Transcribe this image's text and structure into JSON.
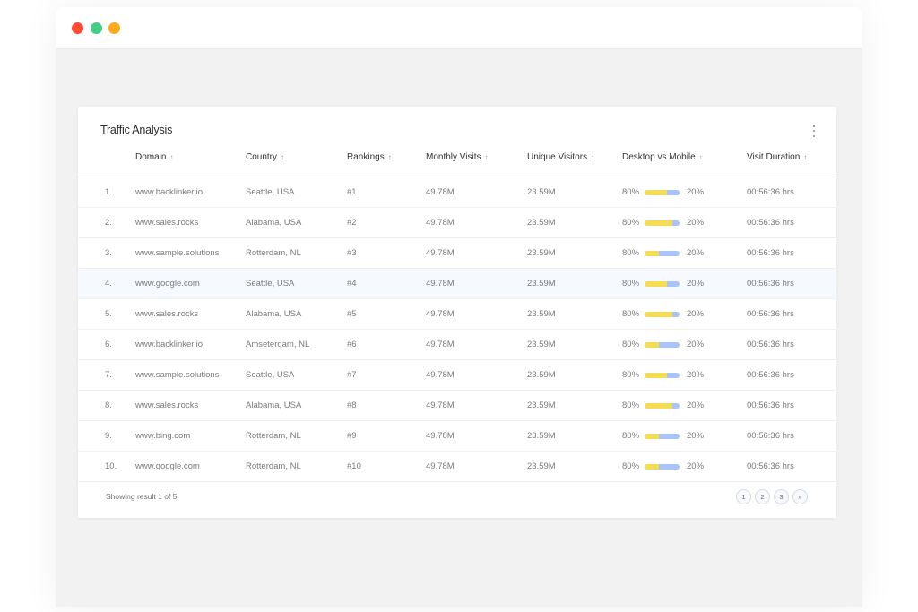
{
  "window": {
    "controls": [
      "close",
      "maximize",
      "minimize"
    ]
  },
  "card": {
    "title": "Traffic Analysis",
    "menu_icon": "more-vertical-icon"
  },
  "table": {
    "sort_icon": "sort-icon",
    "headers": {
      "domain": "Domain",
      "country": "Country",
      "rankings": "Rankings",
      "monthly_visits": "Monthly Visits",
      "unique_visitors": "Unique Visitors",
      "desktop_vs_mobile": "Desktop vs Mobile",
      "visit_duration": "Visit Duration"
    },
    "sort_glyph": "↕",
    "highlighted_row": 4,
    "rows": [
      {
        "num": "1.",
        "domain": "www.backlinker.io",
        "country": "Seattle, USA",
        "rank": "#1",
        "monthly": "49.78M",
        "unique": "23.59M",
        "desktop": "80%",
        "mobile": "20%",
        "desktop_fill": 0.65,
        "duration": "00:56:36 hrs"
      },
      {
        "num": "2.",
        "domain": "www.sales.rocks",
        "country": "Alabama, USA",
        "rank": "#2",
        "monthly": "49.78M",
        "unique": "23.59M",
        "desktop": "80%",
        "mobile": "20%",
        "desktop_fill": 0.8,
        "duration": "00:56:36 hrs"
      },
      {
        "num": "3.",
        "domain": "www.sample.solutions",
        "country": "Rotterdam, NL",
        "rank": "#3",
        "monthly": "49.78M",
        "unique": "23.59M",
        "desktop": "80%",
        "mobile": "20%",
        "desktop_fill": 0.42,
        "duration": "00:56:36 hrs"
      },
      {
        "num": "4.",
        "domain": "www.google.com",
        "country": "Seattle, USA",
        "rank": "#4",
        "monthly": "49.78M",
        "unique": "23.59M",
        "desktop": "80%",
        "mobile": "20%",
        "desktop_fill": 0.65,
        "duration": "00:56:36 hrs"
      },
      {
        "num": "5.",
        "domain": "www.sales.rocks",
        "country": "Alabama, USA",
        "rank": "#5",
        "monthly": "49.78M",
        "unique": "23.59M",
        "desktop": "80%",
        "mobile": "20%",
        "desktop_fill": 0.8,
        "duration": "00:56:36 hrs"
      },
      {
        "num": "6.",
        "domain": "www.backlinker.io",
        "country": "Amseterdam, NL",
        "rank": "#6",
        "monthly": "49.78M",
        "unique": "23.59M",
        "desktop": "80%",
        "mobile": "20%",
        "desktop_fill": 0.42,
        "duration": "00:56:36 hrs"
      },
      {
        "num": "7.",
        "domain": "www.sample.solutions",
        "country": "Seattle, USA",
        "rank": "#7",
        "monthly": "49.78M",
        "unique": "23.59M",
        "desktop": "80%",
        "mobile": "20%",
        "desktop_fill": 0.65,
        "duration": "00:56:36 hrs"
      },
      {
        "num": "8.",
        "domain": "www.sales.rocks",
        "country": "Alabama, USA",
        "rank": "#8",
        "monthly": "49.78M",
        "unique": "23.59M",
        "desktop": "80%",
        "mobile": "20%",
        "desktop_fill": 0.8,
        "duration": "00:56:36 hrs"
      },
      {
        "num": "9.",
        "domain": "www.bing.com",
        "country": "Rotterdam, NL",
        "rank": "#9",
        "monthly": "49.78M",
        "unique": "23.59M",
        "desktop": "80%",
        "mobile": "20%",
        "desktop_fill": 0.42,
        "duration": "00:56:36 hrs"
      },
      {
        "num": "10.",
        "domain": "www.google.com",
        "country": "Rotterdam, NL",
        "rank": "#10",
        "monthly": "49.78M",
        "unique": "23.59M",
        "desktop": "80%",
        "mobile": "20%",
        "desktop_fill": 0.42,
        "duration": "00:56:36 hrs"
      }
    ]
  },
  "footer": {
    "showing": "Showing result 1 of 5",
    "pages": [
      "1",
      "2",
      "3"
    ],
    "next_label": "»"
  },
  "colors": {
    "close": "#fe4b31",
    "maximize": "#44cd87",
    "minimize": "#fdab1a",
    "desktop_bar": "#f5dc55",
    "mobile_bar": "#a9c4fa",
    "highlight_row": "#f6f9fd"
  }
}
